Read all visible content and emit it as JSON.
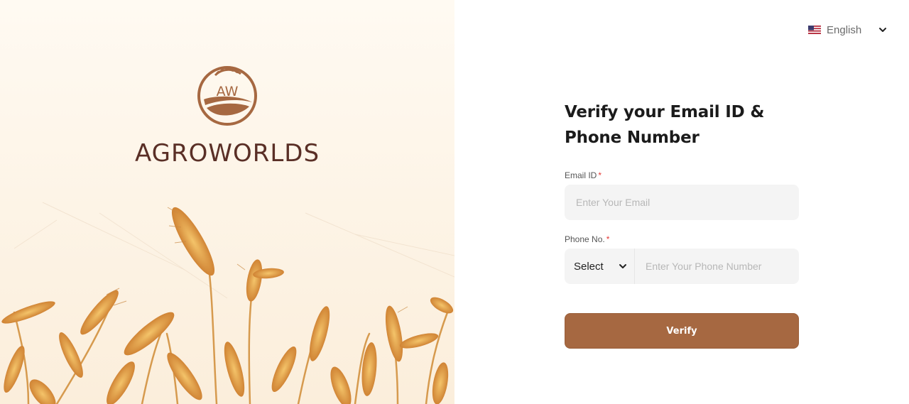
{
  "brand": {
    "emblem_text": "AW",
    "name": "AGROWORLDS"
  },
  "language": {
    "label": "English",
    "flag_icon": "us-flag-icon"
  },
  "form": {
    "title": "Verify your Email ID & Phone Number",
    "email": {
      "label": "Email ID",
      "required_mark": "*",
      "placeholder": "Enter Your Email",
      "value": ""
    },
    "phone": {
      "label": "Phone No.",
      "required_mark": "*",
      "country_code_selected": "Select",
      "placeholder": "Enter Your Phone Number",
      "value": ""
    },
    "submit_label": "Verify"
  },
  "colors": {
    "brand_brown": "#a66841",
    "brand_dark": "#5a2f26",
    "hero_background": "#fff9f0",
    "input_background": "#f4f4f4",
    "required": "#e53935"
  }
}
